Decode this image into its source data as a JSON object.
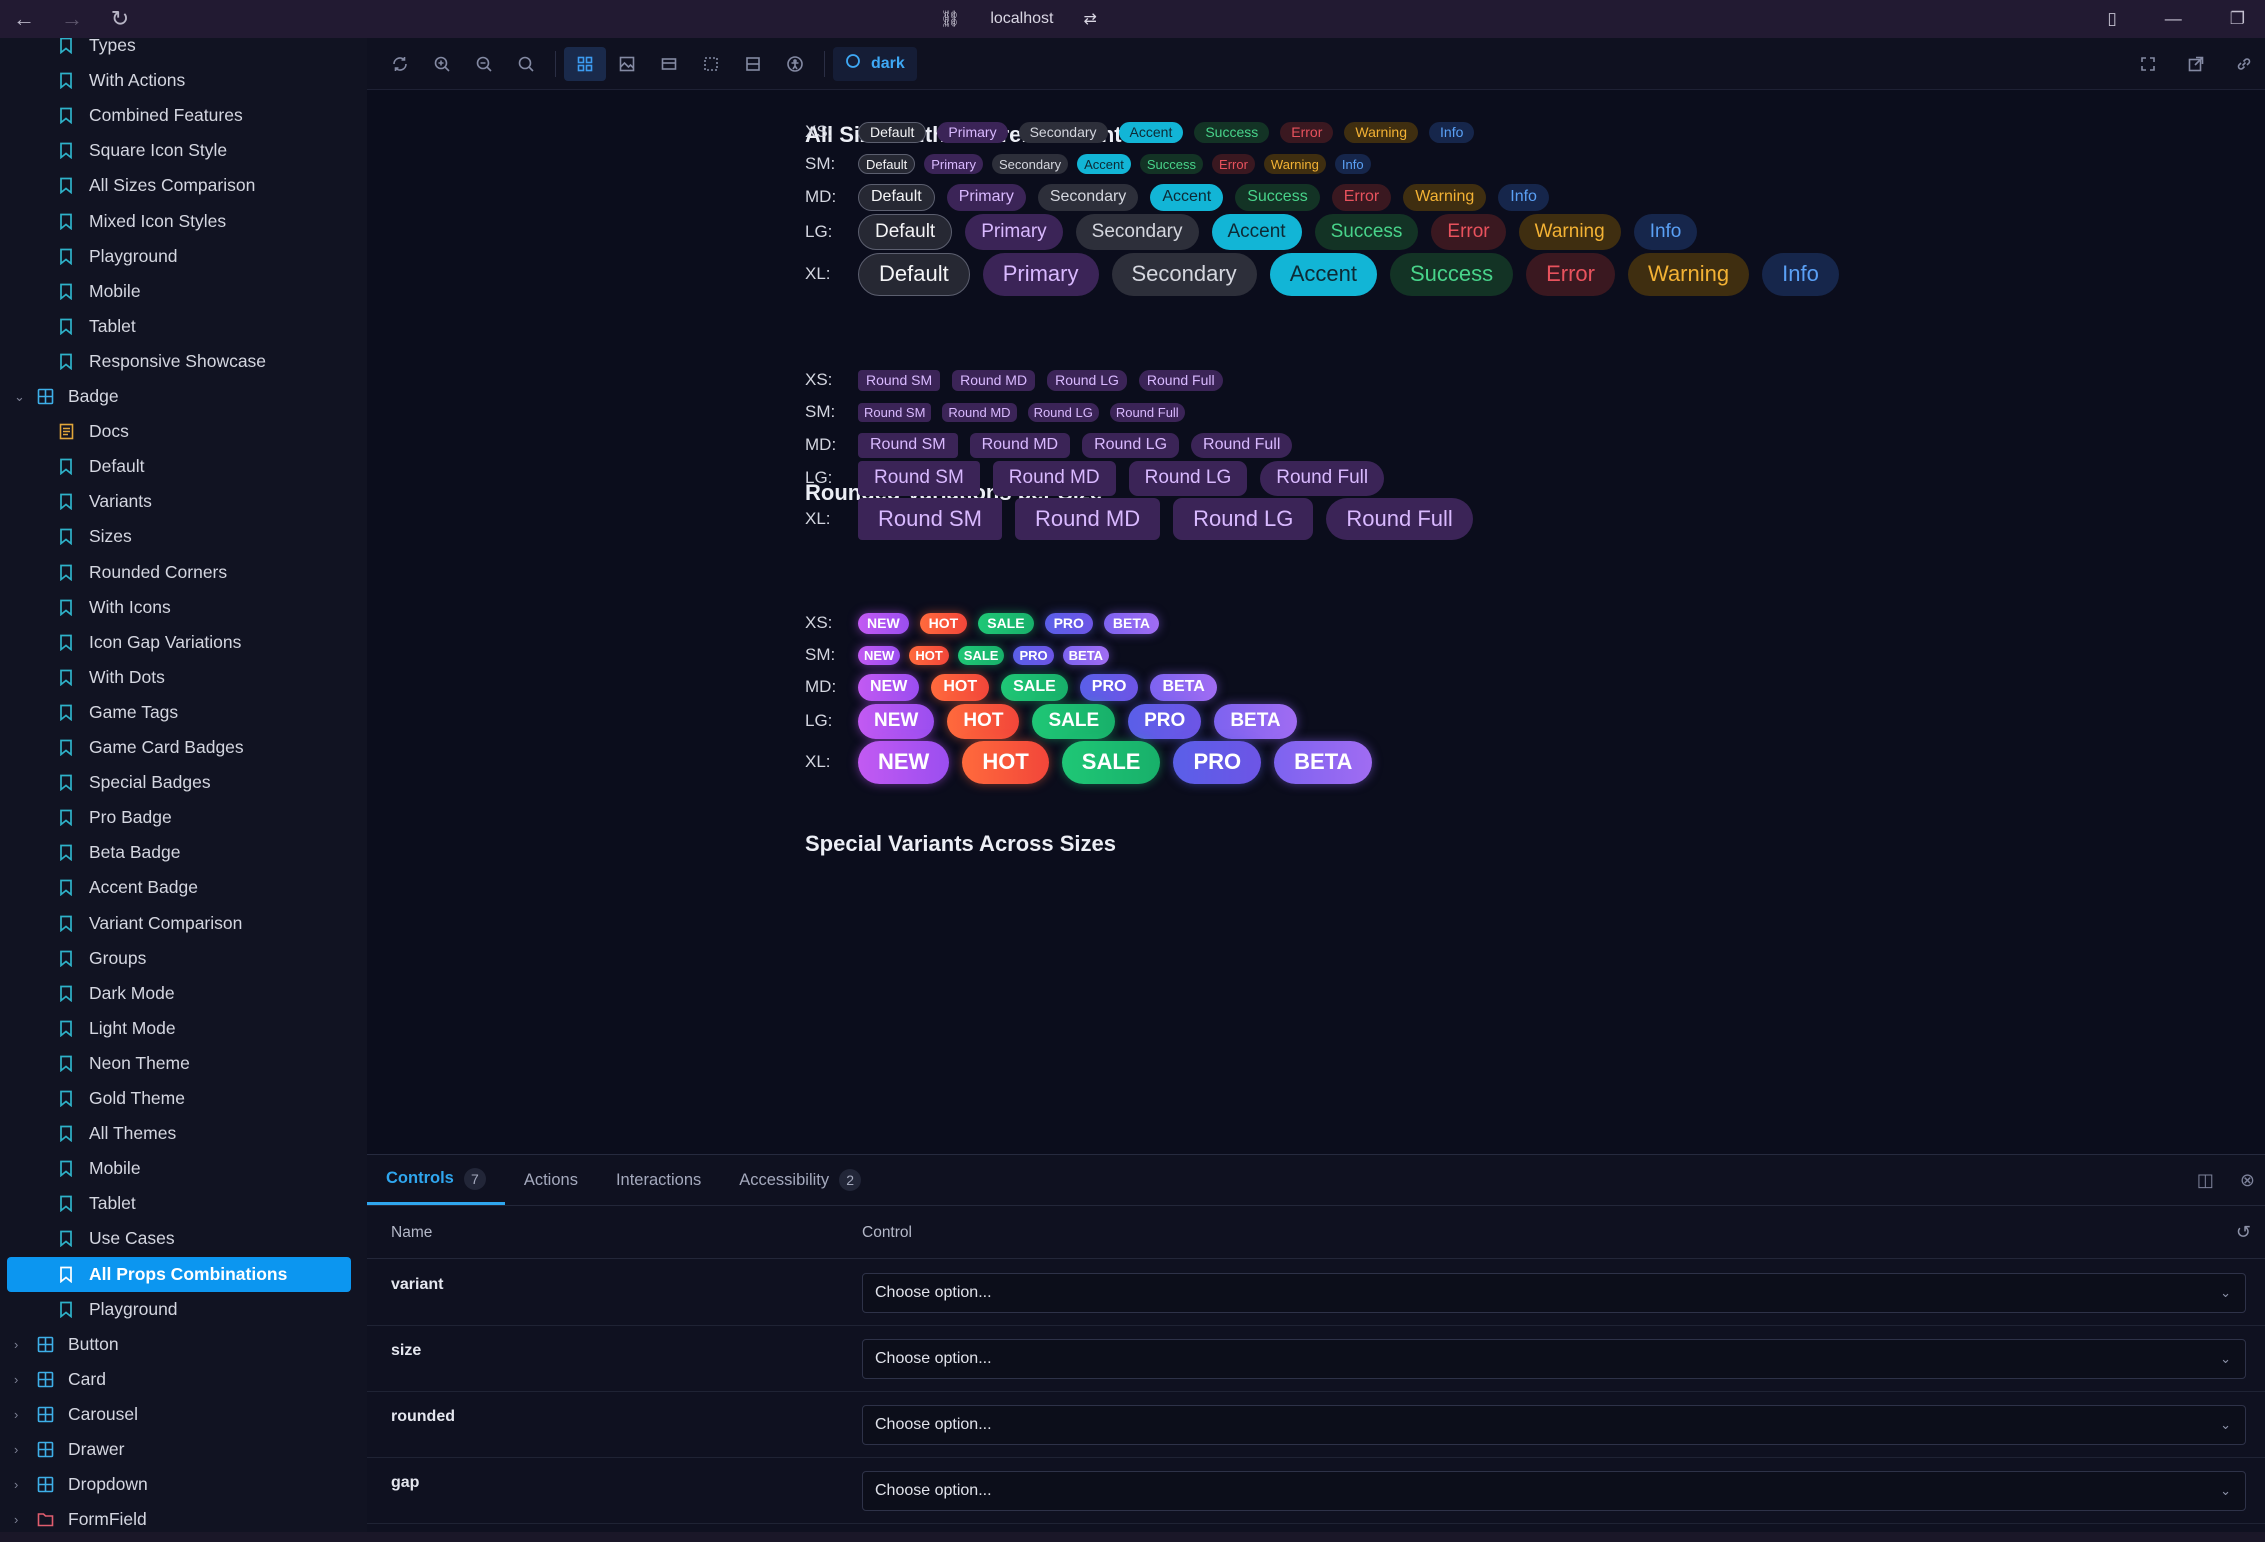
{
  "browser": {
    "url": "localhost"
  },
  "sidebar": {
    "items": [
      {
        "label": "Types",
        "kind": "story"
      },
      {
        "label": "With Actions",
        "kind": "story"
      },
      {
        "label": "Combined Features",
        "kind": "story"
      },
      {
        "label": "Square Icon Style",
        "kind": "story"
      },
      {
        "label": "All Sizes Comparison",
        "kind": "story"
      },
      {
        "label": "Mixed Icon Styles",
        "kind": "story"
      },
      {
        "label": "Playground",
        "kind": "story"
      },
      {
        "label": "Mobile",
        "kind": "story"
      },
      {
        "label": "Tablet",
        "kind": "story"
      },
      {
        "label": "Responsive Showcase",
        "kind": "story"
      },
      {
        "label": "Badge",
        "kind": "component-open"
      },
      {
        "label": "Docs",
        "kind": "docs"
      },
      {
        "label": "Default",
        "kind": "story"
      },
      {
        "label": "Variants",
        "kind": "story"
      },
      {
        "label": "Sizes",
        "kind": "story"
      },
      {
        "label": "Rounded Corners",
        "kind": "story"
      },
      {
        "label": "With Icons",
        "kind": "story"
      },
      {
        "label": "Icon Gap Variations",
        "kind": "story"
      },
      {
        "label": "With Dots",
        "kind": "story"
      },
      {
        "label": "Game Tags",
        "kind": "story"
      },
      {
        "label": "Game Card Badges",
        "kind": "story"
      },
      {
        "label": "Special Badges",
        "kind": "story"
      },
      {
        "label": "Pro Badge",
        "kind": "story"
      },
      {
        "label": "Beta Badge",
        "kind": "story"
      },
      {
        "label": "Accent Badge",
        "kind": "story"
      },
      {
        "label": "Variant Comparison",
        "kind": "story"
      },
      {
        "label": "Groups",
        "kind": "story"
      },
      {
        "label": "Dark Mode",
        "kind": "story"
      },
      {
        "label": "Light Mode",
        "kind": "story"
      },
      {
        "label": "Neon Theme",
        "kind": "story"
      },
      {
        "label": "Gold Theme",
        "kind": "story"
      },
      {
        "label": "All Themes",
        "kind": "story"
      },
      {
        "label": "Mobile",
        "kind": "story"
      },
      {
        "label": "Tablet",
        "kind": "story"
      },
      {
        "label": "Use Cases",
        "kind": "story"
      },
      {
        "label": "All Props Combinations",
        "kind": "story",
        "selected": true
      },
      {
        "label": "Playground",
        "kind": "story"
      },
      {
        "label": "Button",
        "kind": "component"
      },
      {
        "label": "Card",
        "kind": "component"
      },
      {
        "label": "Carousel",
        "kind": "component"
      },
      {
        "label": "Drawer",
        "kind": "component"
      },
      {
        "label": "Dropdown",
        "kind": "component"
      },
      {
        "label": "FormField",
        "kind": "folder"
      }
    ]
  },
  "toolbar": {
    "theme_label": "dark"
  },
  "canvas": {
    "sections": {
      "sizes": {
        "title": "All Sizes with Different Variants",
        "variants": [
          {
            "label": "Default",
            "key": "default"
          },
          {
            "label": "Primary",
            "key": "primary"
          },
          {
            "label": "Secondary",
            "key": "secondary"
          },
          {
            "label": "Accent",
            "key": "accent"
          },
          {
            "label": "Success",
            "key": "success"
          },
          {
            "label": "Error",
            "key": "error"
          },
          {
            "label": "Warning",
            "key": "warning"
          },
          {
            "label": "Info",
            "key": "info"
          }
        ],
        "rows": [
          "XS:",
          "SM:",
          "MD:",
          "LG:",
          "XL:"
        ]
      },
      "rounded": {
        "title": "Rounded Variations per Size",
        "labels": [
          "Round SM",
          "Round MD",
          "Round LG",
          "Round Full"
        ],
        "rows": [
          "XS:",
          "SM:",
          "MD:",
          "LG:",
          "XL:"
        ]
      },
      "special": {
        "title": "Special Variants Across Sizes",
        "labels": [
          "NEW",
          "HOT",
          "SALE",
          "PRO",
          "BETA"
        ],
        "rows": [
          "XS:",
          "SM:",
          "MD:",
          "LG:",
          "XL:"
        ]
      }
    }
  },
  "panel": {
    "tabs": [
      {
        "label": "Controls",
        "count": "7",
        "active": true
      },
      {
        "label": "Actions",
        "count": ""
      },
      {
        "label": "Interactions",
        "count": ""
      },
      {
        "label": "Accessibility",
        "count": "2"
      }
    ],
    "columns": {
      "name": "Name",
      "control": "Control"
    },
    "props": [
      {
        "name": "variant",
        "value": "Choose option..."
      },
      {
        "name": "size",
        "value": "Choose option..."
      },
      {
        "name": "rounded",
        "value": "Choose option..."
      },
      {
        "name": "gap",
        "value": "Choose option..."
      }
    ]
  }
}
